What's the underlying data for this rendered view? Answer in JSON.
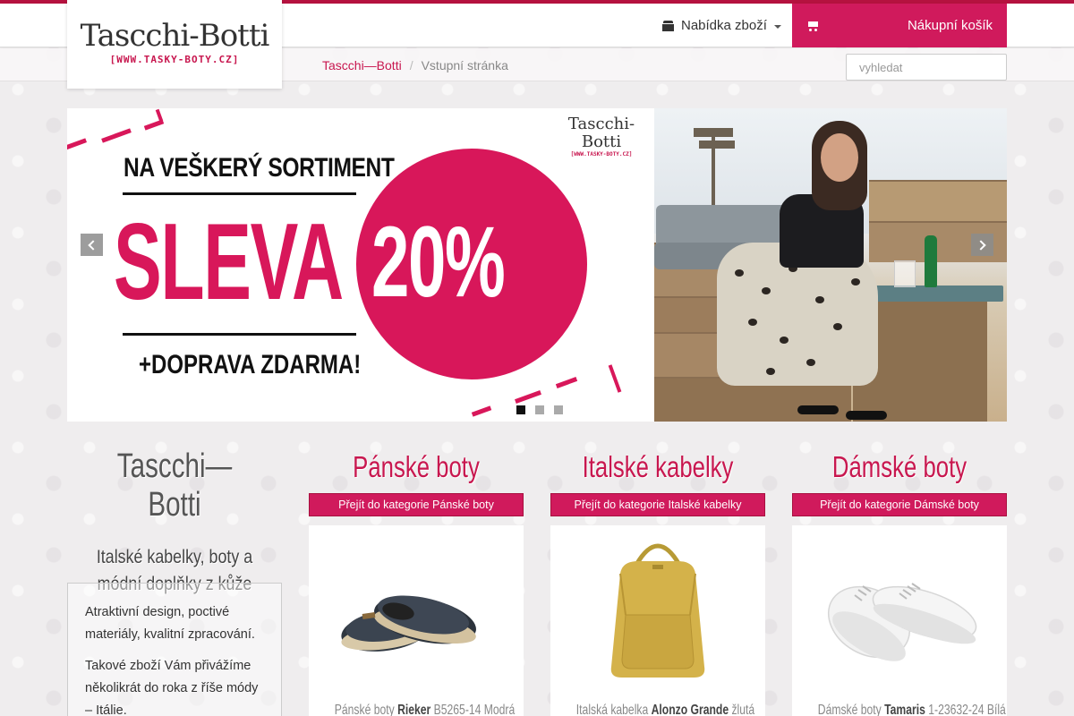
{
  "brand": {
    "logo_main": "Tascchi-Botti",
    "logo_sub": "[WWW.TASKY-BOTY.CZ]"
  },
  "nav": {
    "menu_label": "Nabídka zboží",
    "cart_label": "Nákupní košík"
  },
  "breadcrumb": {
    "home": "Tascchi—Botti",
    "separator": "/",
    "current": "Vstupní stránka"
  },
  "search": {
    "placeholder": "vyhledat",
    "value": ""
  },
  "slider": {
    "promo_top": "NA VEŠKERÝ SORTIMENT",
    "promo_main": "SLEVA",
    "promo_percent": "20%",
    "promo_bottom": "+DOPRAVA ZDARMA!",
    "logo_main": "Tascchi-Botti",
    "logo_sub": "[WWW.TASKY-BOTY.CZ]",
    "dots": 3,
    "active_dot": 1
  },
  "sidebar": {
    "title": "Tascchi—Botti",
    "tagline": "Italské kabelky, boty a módní doplňky z kůže",
    "paragraphs": [
      "Atraktivní design, poctivé materiály, kvalitní zpracování.",
      "Takové zboží Vám přivážíme několikrát do roka z říše módy – Itálie."
    ]
  },
  "categories": [
    {
      "title": "Pánské boty",
      "button": "Přejít do kategorie Pánské boty",
      "caption_prefix": "Pánské boty ",
      "caption_brand": "Rieker",
      "caption_rest": " B5265-14 Modrá"
    },
    {
      "title": "Italské kabelky",
      "button": "Přejít do kategorie Italské kabelky",
      "caption_prefix": "Italská kabelka ",
      "caption_brand": "Alonzo Grande",
      "caption_rest": " žlutá"
    },
    {
      "title": "Dámské boty",
      "button": "Přejít do kategorie Dámské boty",
      "caption_prefix": "Dámské boty ",
      "caption_brand": "Tamaris",
      "caption_rest": " 1-23632-24 Bílá"
    }
  ],
  "colors": {
    "accent": "#d01a5c",
    "promo_pink": "#d8175a",
    "topline": "#b5123f"
  },
  "icons": [
    "gift-icon",
    "caret-down-icon",
    "cart-icon",
    "chevron-left-icon",
    "chevron-right-icon"
  ]
}
